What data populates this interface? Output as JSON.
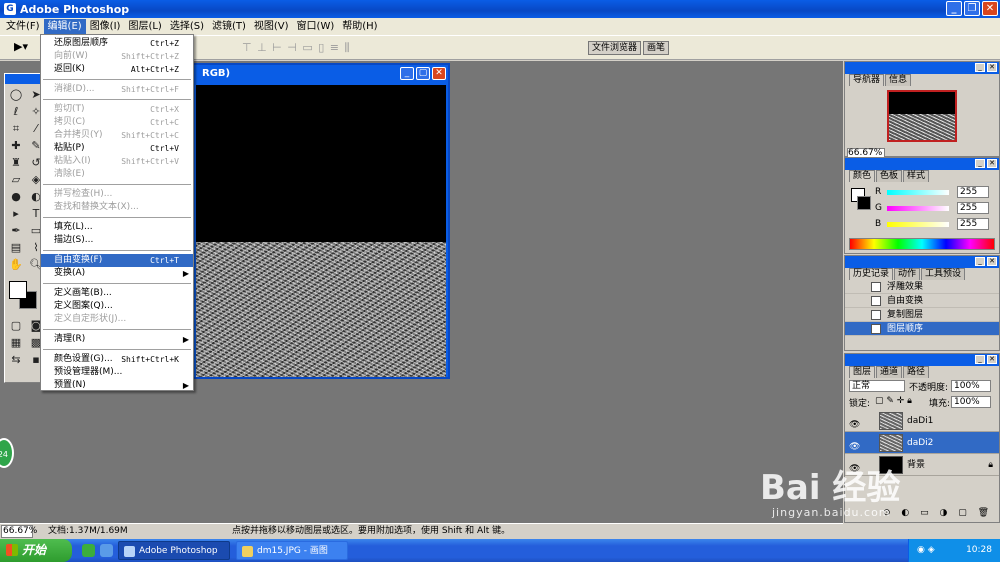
{
  "app": {
    "title": "Adobe Photoshop",
    "icon_letter": "G"
  },
  "menubar": [
    "文件(F)",
    "编辑(E)",
    "图像(I)",
    "图层(L)",
    "选择(S)",
    "滤镜(T)",
    "视图(V)",
    "窗口(W)",
    "帮助(H)"
  ],
  "options_bar": {
    "tool_selector": "▶▾",
    "wells": [
      "文件浏览器",
      "画笔"
    ]
  },
  "edit_menu": {
    "items": [
      {
        "label": "还原图层顺序",
        "shortcut": "Ctrl+Z"
      },
      {
        "label": "向前(W)",
        "shortcut": "Shift+Ctrl+Z",
        "disabled": true
      },
      {
        "label": "返回(K)",
        "shortcut": "Alt+Ctrl+Z"
      },
      {
        "sep": true
      },
      {
        "label": "消褪(D)...",
        "shortcut": "Shift+Ctrl+F",
        "disabled": true
      },
      {
        "sep": true
      },
      {
        "label": "剪切(T)",
        "shortcut": "Ctrl+X",
        "disabled": true
      },
      {
        "label": "拷贝(C)",
        "shortcut": "Ctrl+C",
        "disabled": true
      },
      {
        "label": "合并拷贝(Y)",
        "shortcut": "Shift+Ctrl+C",
        "disabled": true
      },
      {
        "label": "粘贴(P)",
        "shortcut": "Ctrl+V"
      },
      {
        "label": "粘贴入(I)",
        "shortcut": "Shift+Ctrl+V",
        "disabled": true
      },
      {
        "label": "清除(E)",
        "shortcut": "",
        "disabled": true
      },
      {
        "sep": true
      },
      {
        "label": "拼写检查(H)...",
        "shortcut": "",
        "disabled": true
      },
      {
        "label": "查找和替换文本(X)...",
        "shortcut": "",
        "disabled": true
      },
      {
        "sep": true
      },
      {
        "label": "填充(L)...",
        "shortcut": ""
      },
      {
        "label": "描边(S)...",
        "shortcut": ""
      },
      {
        "sep": true
      },
      {
        "label": "自由变换(F)",
        "shortcut": "Ctrl+T",
        "highlighted": true
      },
      {
        "label": "变换(A)",
        "shortcut": "",
        "submenu": true
      },
      {
        "sep": true
      },
      {
        "label": "定义画笔(B)...",
        "shortcut": ""
      },
      {
        "label": "定义图案(Q)...",
        "shortcut": ""
      },
      {
        "label": "定义自定形状(J)...",
        "shortcut": "",
        "disabled": true
      },
      {
        "sep": true
      },
      {
        "label": "清理(R)",
        "shortcut": "",
        "submenu": true
      },
      {
        "sep": true
      },
      {
        "label": "颜色设置(G)...",
        "shortcut": "Shift+Ctrl+K"
      },
      {
        "label": "预设管理器(M)...",
        "shortcut": ""
      },
      {
        "label": "预置(N)",
        "shortcut": "",
        "submenu": true
      }
    ]
  },
  "document": {
    "title_suffix": "RGB)"
  },
  "navigator": {
    "tabs": [
      "导航器",
      "信息"
    ],
    "zoom": "66.67%"
  },
  "color_panel": {
    "tabs": [
      "颜色",
      "色板",
      "样式"
    ],
    "channels": [
      {
        "label": "R",
        "value": "255",
        "color": "#ff3030"
      },
      {
        "label": "G",
        "value": "255",
        "color": "#30d030"
      },
      {
        "label": "B",
        "value": "255",
        "color": "#3030ff"
      }
    ]
  },
  "history_panel": {
    "tabs": [
      "历史记录",
      "动作",
      "工具预设"
    ],
    "items": [
      "浮雕效果",
      "自由变换",
      "复制图层",
      "图层顺序"
    ],
    "active_index": 3
  },
  "layers_panel": {
    "tabs": [
      "图层",
      "通道",
      "路径"
    ],
    "blend_mode": "正常",
    "opacity_label": "不透明度:",
    "opacity": "100%",
    "lock_label": "锁定:",
    "fill_label": "填充:",
    "fill": "100%",
    "layers": [
      {
        "name": "daDi1",
        "active": false,
        "lock": false
      },
      {
        "name": "daDi2",
        "active": true,
        "lock": false
      },
      {
        "name": "背景",
        "active": false,
        "lock": true
      }
    ]
  },
  "statusbar": {
    "zoom": "66.67%",
    "doc_info": "文档:1.37M/1.69M",
    "hint": "点按并拖移以移动图层或选区。要用附加选项，使用 Shift 和 Alt 键。"
  },
  "taskbar": {
    "start": "开始",
    "tasks": [
      "Adobe Photoshop",
      "dm15.JPG - 画图"
    ],
    "clock": "10:28"
  },
  "overlay": {
    "badge": "24",
    "watermark_big": "Bai 经验",
    "watermark_small": "jingyan.baidu.com"
  }
}
